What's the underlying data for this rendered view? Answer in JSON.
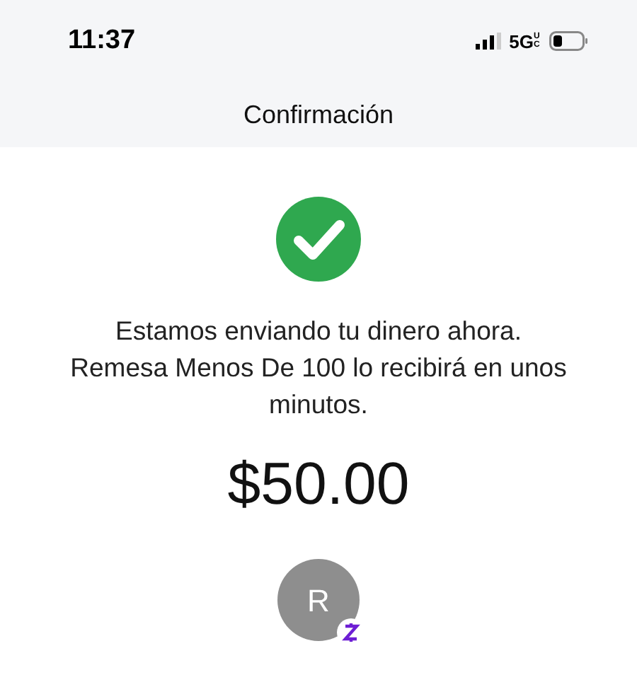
{
  "status_bar": {
    "time": "11:37",
    "network": "5G",
    "network_suffix": "UC"
  },
  "header": {
    "title": "Confirmación"
  },
  "message": "Estamos enviando tu dinero ahora. Remesa Menos De 100 lo recibirá en unos minutos.",
  "amount": "$50.00",
  "recipient": {
    "initial": "R"
  }
}
